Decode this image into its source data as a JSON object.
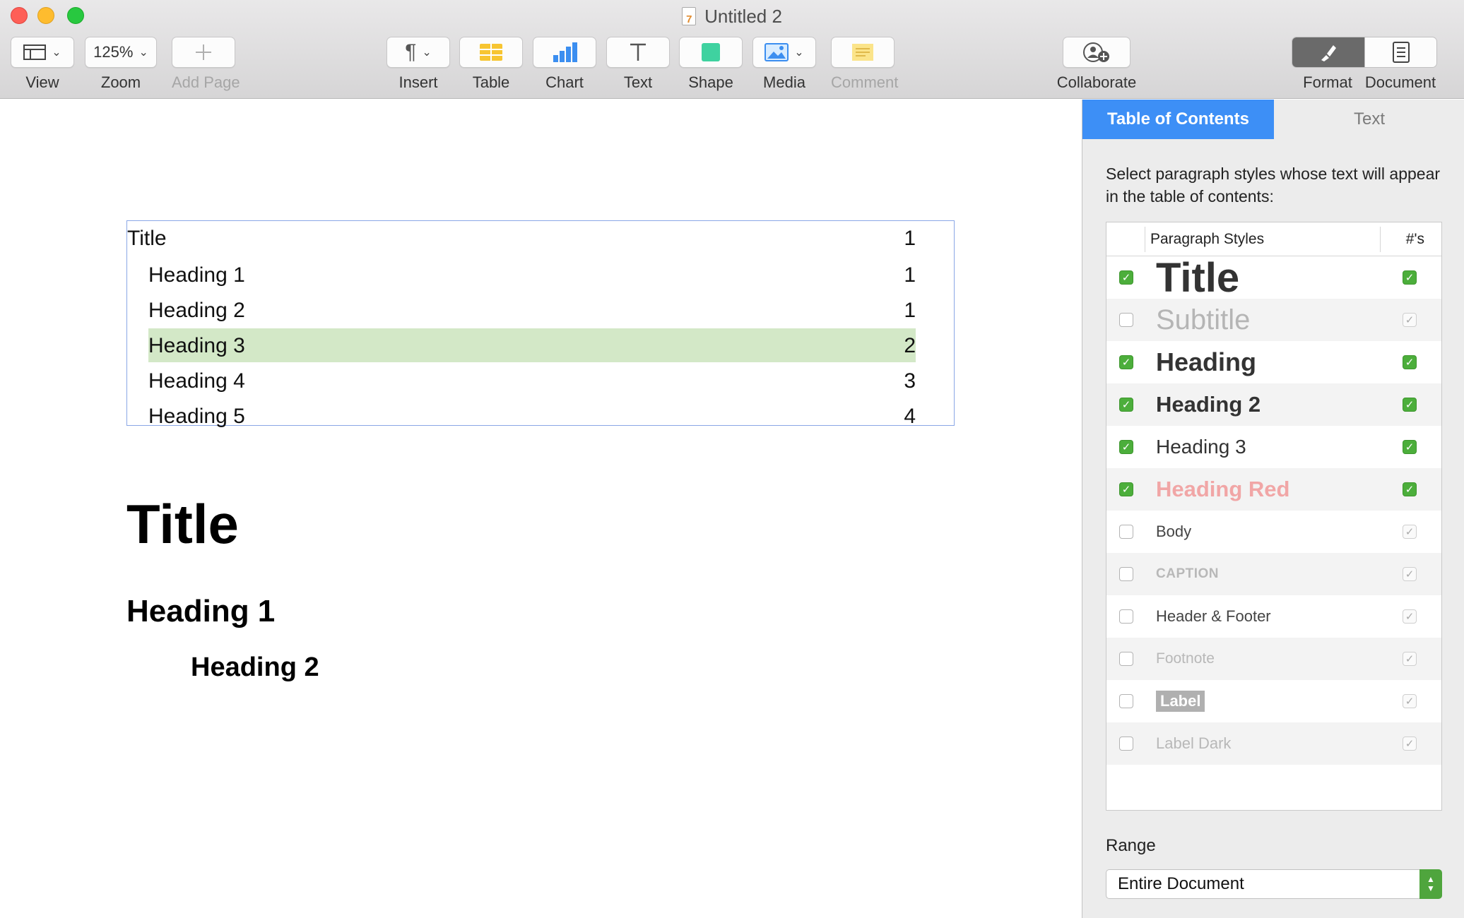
{
  "window": {
    "title": "Untitled 2"
  },
  "toolbar": {
    "view": {
      "label": "View"
    },
    "zoom": {
      "value": "125%",
      "label": "Zoom"
    },
    "add_page": {
      "label": "Add Page"
    },
    "insert": {
      "label": "Insert"
    },
    "table": {
      "label": "Table"
    },
    "chart": {
      "label": "Chart"
    },
    "text": {
      "label": "Text"
    },
    "shape": {
      "label": "Shape"
    },
    "media": {
      "label": "Media"
    },
    "comment": {
      "label": "Comment"
    },
    "collaborate": {
      "label": "Collaborate"
    },
    "format": {
      "label": "Format",
      "active": true
    },
    "document": {
      "label": "Document"
    }
  },
  "document": {
    "toc": [
      {
        "text": "Title",
        "page": "1",
        "highlighted": false
      },
      {
        "text": "Heading 1",
        "page": "1",
        "highlighted": false
      },
      {
        "text": "Heading 2",
        "page": "1",
        "highlighted": false
      },
      {
        "text": "Heading 3",
        "page": "2",
        "highlighted": true
      },
      {
        "text": "Heading 4",
        "page": "3",
        "highlighted": false
      },
      {
        "text": "Heading 5",
        "page": "4",
        "highlighted": false
      }
    ],
    "title": "Title",
    "heading1": "Heading 1",
    "heading2": "Heading 2"
  },
  "inspector": {
    "tabs": [
      {
        "label": "Table of Contents",
        "active": true
      },
      {
        "label": "Text",
        "active": false
      }
    ],
    "description": "Select paragraph styles whose text will appear in the table of contents:",
    "table": {
      "header_styles": "Paragraph Styles",
      "header_numbers": "#'s",
      "rows": [
        {
          "name": "Title",
          "included": true,
          "numbers": true
        },
        {
          "name": "Subtitle",
          "included": false,
          "numbers": true
        },
        {
          "name": "Heading",
          "included": true,
          "numbers": true
        },
        {
          "name": "Heading 2",
          "included": true,
          "numbers": true
        },
        {
          "name": "Heading 3",
          "included": true,
          "numbers": true
        },
        {
          "name": "Heading Red",
          "included": true,
          "numbers": true
        },
        {
          "name": "Body",
          "included": false,
          "numbers": true
        },
        {
          "name": "CAPTION",
          "included": false,
          "numbers": true
        },
        {
          "name": "Header & Footer",
          "included": false,
          "numbers": true
        },
        {
          "name": "Footnote",
          "included": false,
          "numbers": true
        },
        {
          "name": "Label",
          "included": false,
          "numbers": true
        },
        {
          "name": "Label Dark",
          "included": false,
          "numbers": true
        }
      ]
    },
    "range": {
      "label": "Range",
      "value": "Entire Document"
    }
  },
  "colors": {
    "accent_blue": "#3d8ff6",
    "check_green": "#4cae3b",
    "toc_highlight": "#d3e8c7",
    "heading_red": "#f1a6a6"
  }
}
